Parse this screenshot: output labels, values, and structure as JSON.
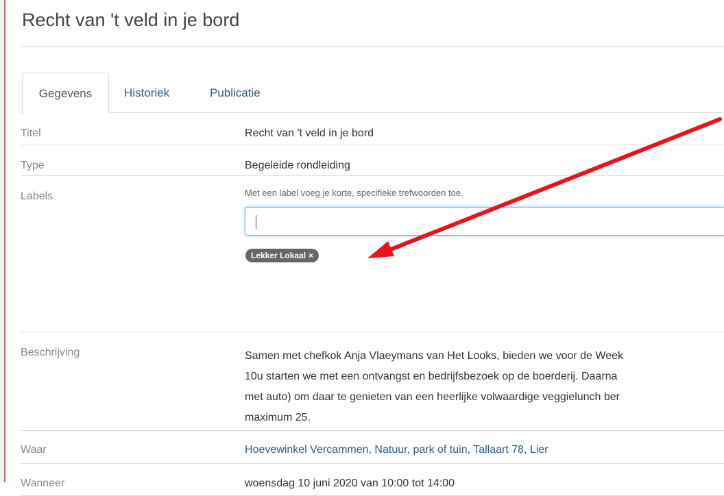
{
  "page": {
    "title": "Recht van 't veld in je bord"
  },
  "tabs": [
    {
      "label": "Gegevens",
      "active": true
    },
    {
      "label": "Historiek",
      "active": false
    },
    {
      "label": "Publicatie",
      "active": false
    }
  ],
  "details": {
    "titel": {
      "label": "Titel",
      "value": "Recht van 't veld in je bord"
    },
    "type": {
      "label": "Type",
      "value": "Begeleide rondleiding"
    },
    "labels": {
      "label": "Labels",
      "help": "Met een label voeg je korte, specifieke trefwoorden toe.",
      "input_value": "",
      "tags": [
        {
          "text": "Lekker Lokaal",
          "remove": "×"
        }
      ]
    },
    "beschrijving": {
      "label": "Beschrijving",
      "lines": [
        "Samen met chefkok Anja Vlaeymans van Het Looks, bieden we voor de Week",
        "10u starten we met een ontvangst en bedrijfsbezoek op de boerderij. Daarna",
        "met auto) om daar te genieten van een heerlijke volwaardige veggielunch ber",
        "maximum 25."
      ]
    },
    "waar": {
      "label": "Waar",
      "value": "Hoevewinkel Vercammen, Natuur, park of tuin, Tallaart 78, Lier"
    },
    "wanneer": {
      "label": "Wanneer",
      "value": "woensdag 10 juni 2020 van 10:00 tot 14:00"
    }
  },
  "colors": {
    "link": "#2a5b8c",
    "tag_bg": "#666666",
    "annotation_arrow": "#e8141b"
  }
}
